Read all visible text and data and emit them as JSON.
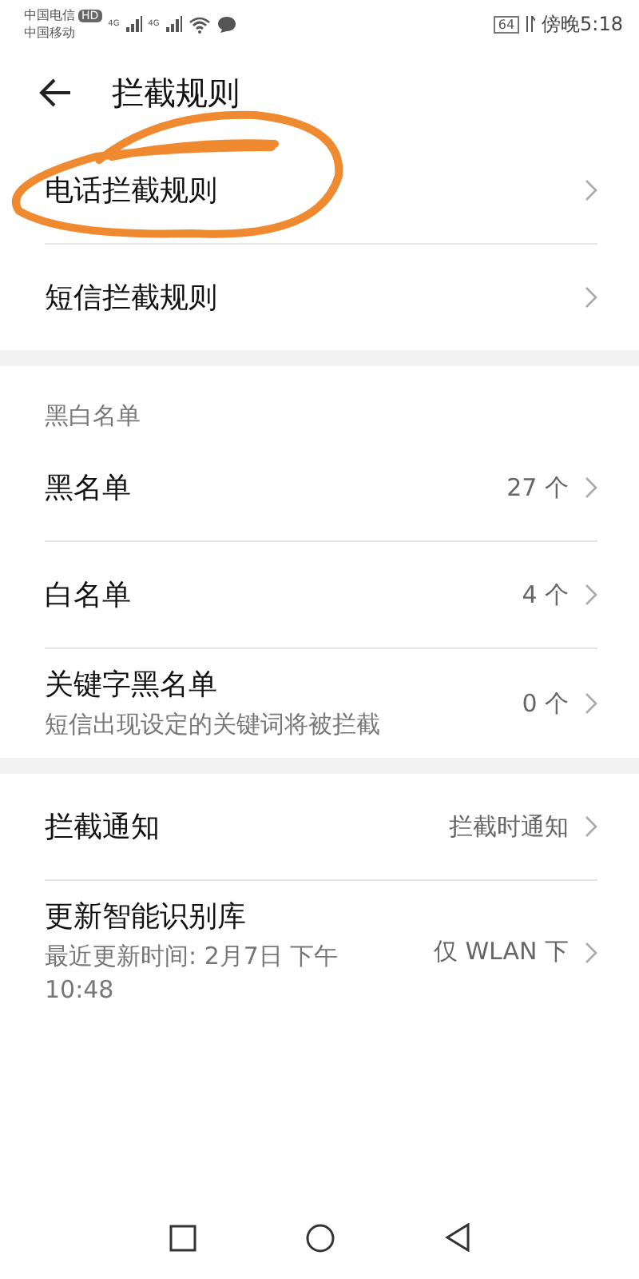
{
  "status_bar": {
    "carrier_1": "中国电信",
    "hd_badge": "HD",
    "network_1": "4G",
    "network_2": "4G",
    "carrier_2": "中国移动",
    "battery": "64",
    "time": "傍晚5:18"
  },
  "header": {
    "title": "拦截规则"
  },
  "sections": [
    {
      "rows": [
        {
          "title": "电话拦截规则"
        },
        {
          "title": "短信拦截规则"
        }
      ]
    },
    {
      "heading": "黑白名单",
      "rows": [
        {
          "title": "黑名单",
          "value": "27 个"
        },
        {
          "title": "白名单",
          "value": "4 个"
        },
        {
          "title": "关键字黑名单",
          "subtitle": "短信出现设定的关键词将被拦截",
          "value": "0 个"
        }
      ]
    },
    {
      "rows": [
        {
          "title": "拦截通知",
          "value": "拦截时通知"
        },
        {
          "title": "更新智能识别库",
          "subtitle": "最近更新时间: 2月7日 下午 10:48",
          "value": "仅 WLAN 下"
        }
      ]
    }
  ]
}
